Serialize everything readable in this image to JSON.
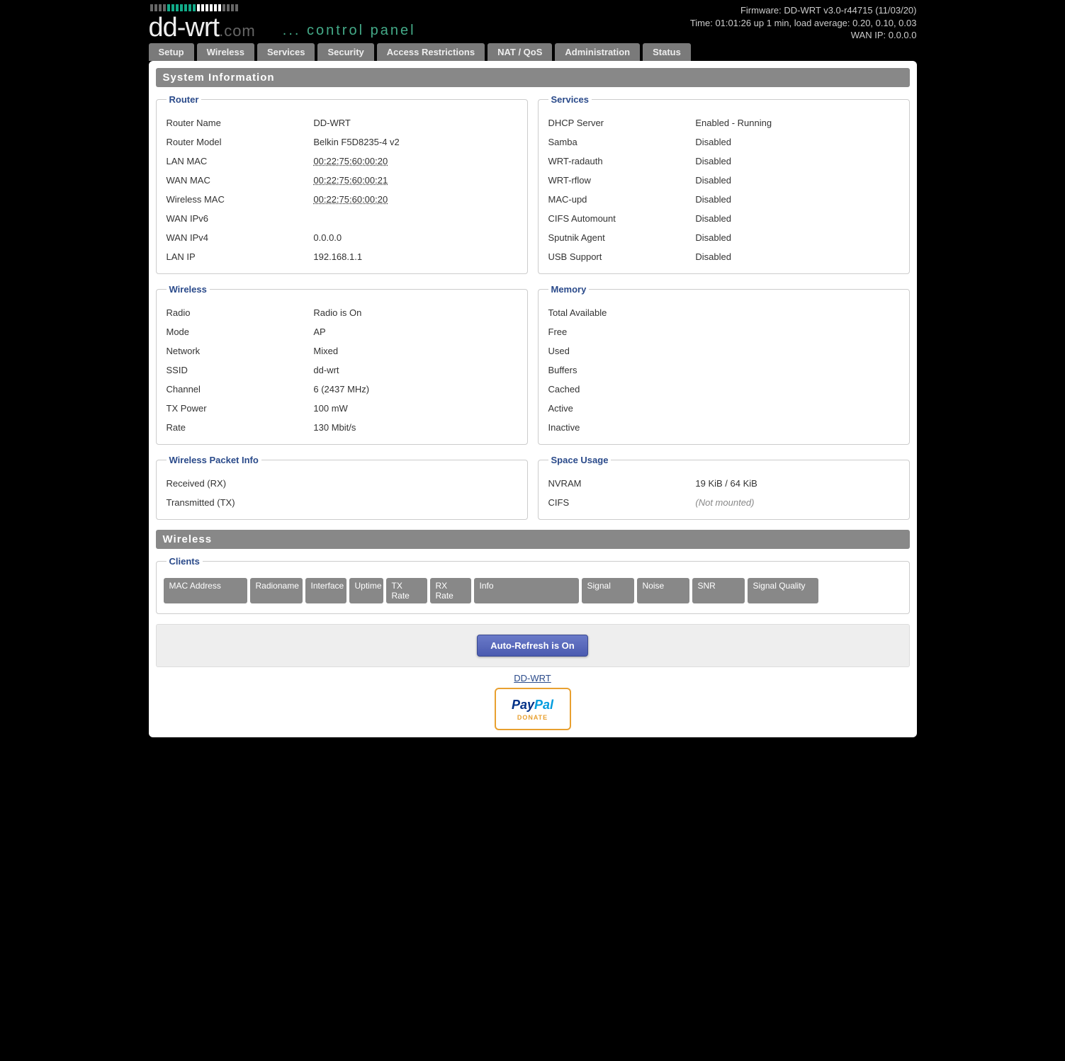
{
  "header": {
    "firmware": "Firmware: DD-WRT v3.0-r44715 (11/03/20)",
    "time": "Time: 01:01:26 up 1 min, load average: 0.20, 0.10, 0.03",
    "wanip": "WAN IP: 0.0.0.0",
    "cp": "... control panel"
  },
  "tabs": [
    "Setup",
    "Wireless",
    "Services",
    "Security",
    "Access Restrictions",
    "NAT / QoS",
    "Administration",
    "Status"
  ],
  "section_sysinfo": "System Information",
  "router": {
    "legend": "Router",
    "rows": [
      {
        "l": "Router Name",
        "v": "DD-WRT"
      },
      {
        "l": "Router Model",
        "v": "Belkin F5D8235-4 v2"
      },
      {
        "l": "LAN MAC",
        "v": "00:22:75:60:00:20",
        "mac": true
      },
      {
        "l": "WAN MAC",
        "v": "00:22:75:60:00:21",
        "mac": true
      },
      {
        "l": "Wireless MAC",
        "v": "00:22:75:60:00:20",
        "mac": true
      },
      {
        "l": "WAN IPv6",
        "v": ""
      },
      {
        "l": "WAN IPv4",
        "v": "0.0.0.0"
      },
      {
        "l": "LAN IP",
        "v": "192.168.1.1"
      }
    ]
  },
  "services": {
    "legend": "Services",
    "rows": [
      {
        "l": "DHCP Server",
        "v": "Enabled - Running"
      },
      {
        "l": "Samba",
        "v": "Disabled"
      },
      {
        "l": "WRT-radauth",
        "v": "Disabled"
      },
      {
        "l": "WRT-rflow",
        "v": "Disabled"
      },
      {
        "l": "MAC-upd",
        "v": "Disabled"
      },
      {
        "l": "CIFS Automount",
        "v": "Disabled"
      },
      {
        "l": "Sputnik Agent",
        "v": "Disabled"
      },
      {
        "l": "USB Support",
        "v": "Disabled"
      }
    ]
  },
  "wireless": {
    "legend": "Wireless",
    "rows": [
      {
        "l": "Radio",
        "v": "Radio is On"
      },
      {
        "l": "Mode",
        "v": "AP"
      },
      {
        "l": "Network",
        "v": "Mixed"
      },
      {
        "l": "SSID",
        "v": "dd-wrt"
      },
      {
        "l": "Channel",
        "v": "6 (2437 MHz)"
      },
      {
        "l": "TX Power",
        "v": "100 mW"
      },
      {
        "l": "Rate",
        "v": "130 Mbit/s"
      }
    ]
  },
  "memory": {
    "legend": "Memory",
    "rows": [
      {
        "l": "Total Available",
        "v": ""
      },
      {
        "l": "Free",
        "v": ""
      },
      {
        "l": "Used",
        "v": ""
      },
      {
        "l": "Buffers",
        "v": ""
      },
      {
        "l": "Cached",
        "v": ""
      },
      {
        "l": "Active",
        "v": ""
      },
      {
        "l": "Inactive",
        "v": ""
      }
    ]
  },
  "wpi": {
    "legend": "Wireless Packet Info",
    "rows": [
      {
        "l": "Received (RX)",
        "v": ""
      },
      {
        "l": "Transmitted (TX)",
        "v": ""
      }
    ]
  },
  "space": {
    "legend": "Space Usage",
    "rows": [
      {
        "l": "NVRAM",
        "v": "19 KiB / 64 KiB"
      },
      {
        "l": "CIFS",
        "v": "(Not mounted)",
        "italic": true
      }
    ]
  },
  "section_wireless": "Wireless",
  "clients": {
    "legend": "Clients",
    "headers": [
      "MAC Address",
      "Radioname",
      "Interface",
      "Uptime",
      "TX Rate",
      "RX Rate",
      "Info",
      "Signal",
      "Noise",
      "SNR",
      "Signal Quality"
    ],
    "widths": [
      118,
      74,
      58,
      48,
      58,
      58,
      148,
      74,
      74,
      74,
      100
    ]
  },
  "footer": {
    "refresh": "Auto-Refresh is On",
    "link": "DD-WRT",
    "donate": "DONATE"
  }
}
